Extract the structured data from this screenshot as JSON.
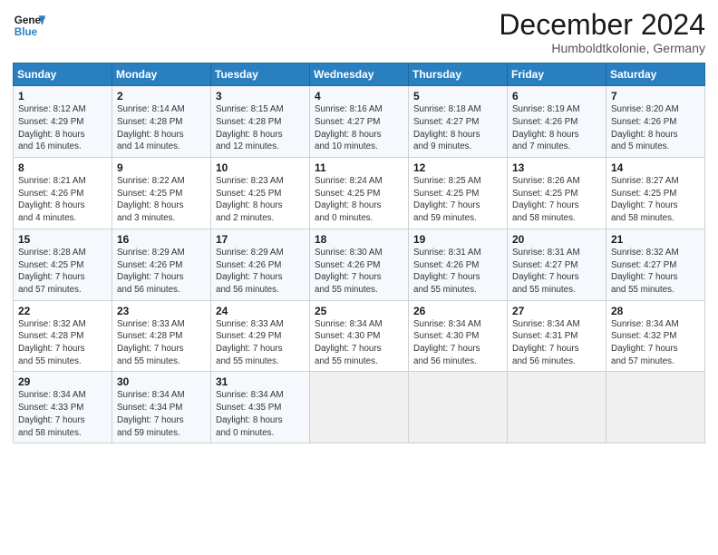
{
  "logo": {
    "line1": "General",
    "line2": "Blue"
  },
  "title": "December 2024",
  "location": "Humboldtkolonie, Germany",
  "days_header": [
    "Sunday",
    "Monday",
    "Tuesday",
    "Wednesday",
    "Thursday",
    "Friday",
    "Saturday"
  ],
  "weeks": [
    [
      {
        "day": "1",
        "info": "Sunrise: 8:12 AM\nSunset: 4:29 PM\nDaylight: 8 hours\nand 16 minutes."
      },
      {
        "day": "2",
        "info": "Sunrise: 8:14 AM\nSunset: 4:28 PM\nDaylight: 8 hours\nand 14 minutes."
      },
      {
        "day": "3",
        "info": "Sunrise: 8:15 AM\nSunset: 4:28 PM\nDaylight: 8 hours\nand 12 minutes."
      },
      {
        "day": "4",
        "info": "Sunrise: 8:16 AM\nSunset: 4:27 PM\nDaylight: 8 hours\nand 10 minutes."
      },
      {
        "day": "5",
        "info": "Sunrise: 8:18 AM\nSunset: 4:27 PM\nDaylight: 8 hours\nand 9 minutes."
      },
      {
        "day": "6",
        "info": "Sunrise: 8:19 AM\nSunset: 4:26 PM\nDaylight: 8 hours\nand 7 minutes."
      },
      {
        "day": "7",
        "info": "Sunrise: 8:20 AM\nSunset: 4:26 PM\nDaylight: 8 hours\nand 5 minutes."
      }
    ],
    [
      {
        "day": "8",
        "info": "Sunrise: 8:21 AM\nSunset: 4:26 PM\nDaylight: 8 hours\nand 4 minutes."
      },
      {
        "day": "9",
        "info": "Sunrise: 8:22 AM\nSunset: 4:25 PM\nDaylight: 8 hours\nand 3 minutes."
      },
      {
        "day": "10",
        "info": "Sunrise: 8:23 AM\nSunset: 4:25 PM\nDaylight: 8 hours\nand 2 minutes."
      },
      {
        "day": "11",
        "info": "Sunrise: 8:24 AM\nSunset: 4:25 PM\nDaylight: 8 hours\nand 0 minutes."
      },
      {
        "day": "12",
        "info": "Sunrise: 8:25 AM\nSunset: 4:25 PM\nDaylight: 7 hours\nand 59 minutes."
      },
      {
        "day": "13",
        "info": "Sunrise: 8:26 AM\nSunset: 4:25 PM\nDaylight: 7 hours\nand 58 minutes."
      },
      {
        "day": "14",
        "info": "Sunrise: 8:27 AM\nSunset: 4:25 PM\nDaylight: 7 hours\nand 58 minutes."
      }
    ],
    [
      {
        "day": "15",
        "info": "Sunrise: 8:28 AM\nSunset: 4:25 PM\nDaylight: 7 hours\nand 57 minutes."
      },
      {
        "day": "16",
        "info": "Sunrise: 8:29 AM\nSunset: 4:26 PM\nDaylight: 7 hours\nand 56 minutes."
      },
      {
        "day": "17",
        "info": "Sunrise: 8:29 AM\nSunset: 4:26 PM\nDaylight: 7 hours\nand 56 minutes."
      },
      {
        "day": "18",
        "info": "Sunrise: 8:30 AM\nSunset: 4:26 PM\nDaylight: 7 hours\nand 55 minutes."
      },
      {
        "day": "19",
        "info": "Sunrise: 8:31 AM\nSunset: 4:26 PM\nDaylight: 7 hours\nand 55 minutes."
      },
      {
        "day": "20",
        "info": "Sunrise: 8:31 AM\nSunset: 4:27 PM\nDaylight: 7 hours\nand 55 minutes."
      },
      {
        "day": "21",
        "info": "Sunrise: 8:32 AM\nSunset: 4:27 PM\nDaylight: 7 hours\nand 55 minutes."
      }
    ],
    [
      {
        "day": "22",
        "info": "Sunrise: 8:32 AM\nSunset: 4:28 PM\nDaylight: 7 hours\nand 55 minutes."
      },
      {
        "day": "23",
        "info": "Sunrise: 8:33 AM\nSunset: 4:28 PM\nDaylight: 7 hours\nand 55 minutes."
      },
      {
        "day": "24",
        "info": "Sunrise: 8:33 AM\nSunset: 4:29 PM\nDaylight: 7 hours\nand 55 minutes."
      },
      {
        "day": "25",
        "info": "Sunrise: 8:34 AM\nSunset: 4:30 PM\nDaylight: 7 hours\nand 55 minutes."
      },
      {
        "day": "26",
        "info": "Sunrise: 8:34 AM\nSunset: 4:30 PM\nDaylight: 7 hours\nand 56 minutes."
      },
      {
        "day": "27",
        "info": "Sunrise: 8:34 AM\nSunset: 4:31 PM\nDaylight: 7 hours\nand 56 minutes."
      },
      {
        "day": "28",
        "info": "Sunrise: 8:34 AM\nSunset: 4:32 PM\nDaylight: 7 hours\nand 57 minutes."
      }
    ],
    [
      {
        "day": "29",
        "info": "Sunrise: 8:34 AM\nSunset: 4:33 PM\nDaylight: 7 hours\nand 58 minutes."
      },
      {
        "day": "30",
        "info": "Sunrise: 8:34 AM\nSunset: 4:34 PM\nDaylight: 7 hours\nand 59 minutes."
      },
      {
        "day": "31",
        "info": "Sunrise: 8:34 AM\nSunset: 4:35 PM\nDaylight: 8 hours\nand 0 minutes."
      },
      {
        "day": "",
        "info": ""
      },
      {
        "day": "",
        "info": ""
      },
      {
        "day": "",
        "info": ""
      },
      {
        "day": "",
        "info": ""
      }
    ]
  ]
}
